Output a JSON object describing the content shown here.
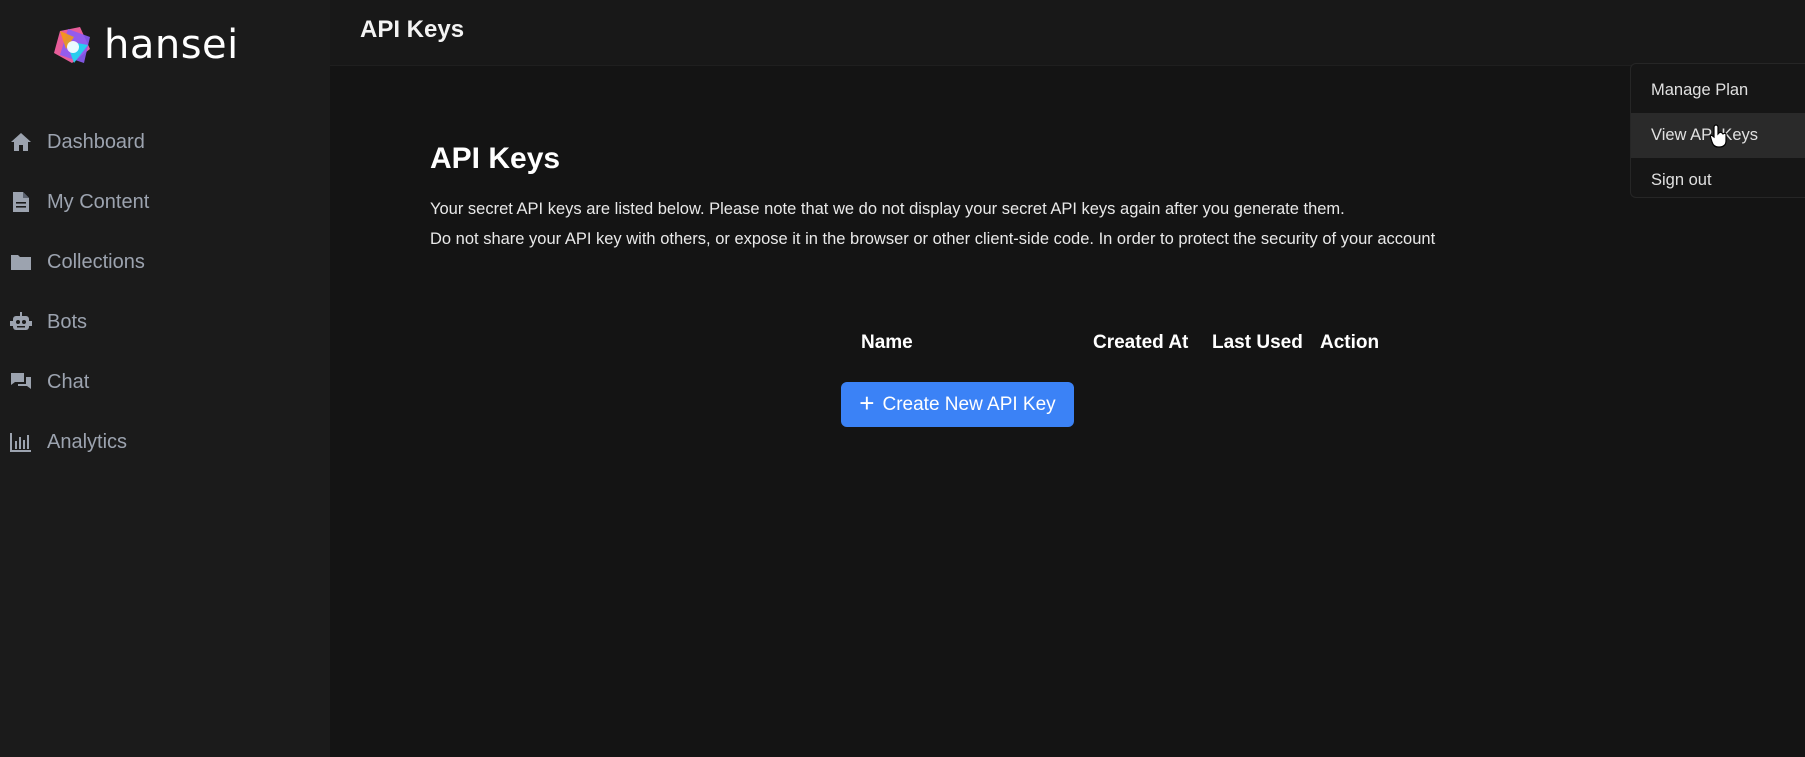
{
  "app": {
    "name": "hansei"
  },
  "sidebar": {
    "items": [
      {
        "label": "Dashboard",
        "icon": "home-icon"
      },
      {
        "label": "My Content",
        "icon": "file-icon"
      },
      {
        "label": "Collections",
        "icon": "folder-icon"
      },
      {
        "label": "Bots",
        "icon": "robot-icon"
      },
      {
        "label": "Chat",
        "icon": "chat-icon"
      },
      {
        "label": "Analytics",
        "icon": "bar-chart-icon"
      }
    ]
  },
  "header": {
    "title": "API Keys"
  },
  "main": {
    "heading": "API Keys",
    "description_line1": "Your secret API keys are listed below. Please note that we do not display your secret API keys again after you generate them.",
    "description_line2": "Do not share your API key with others, or expose it in the browser or other client-side code. In order to protect the security of your account",
    "table": {
      "columns": [
        "Name",
        "Created At",
        "Last Used",
        "Action"
      ],
      "rows": []
    },
    "create_button": {
      "label": "Create New API Key",
      "icon": "plus-icon"
    }
  },
  "user_menu": {
    "items": [
      {
        "label": "Manage Plan"
      },
      {
        "label": "View API Keys",
        "hovered": true
      },
      {
        "label": "Sign out"
      }
    ]
  },
  "colors": {
    "accent": "#3b82f6",
    "sidebar_bg": "#1b1b1b",
    "main_bg": "#141414"
  }
}
